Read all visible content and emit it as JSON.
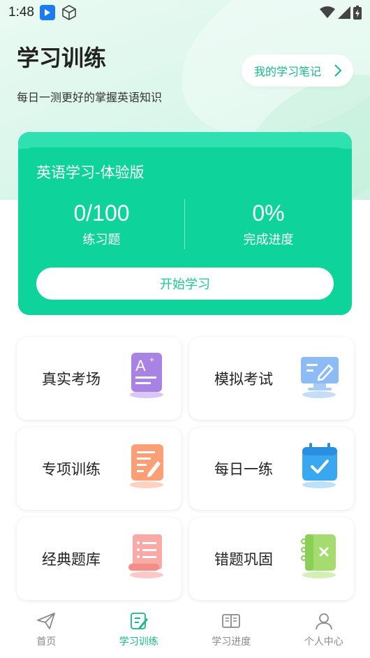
{
  "status_bar": {
    "time": "1:48"
  },
  "header": {
    "title": "学习训练",
    "subtitle": "每日一测更好的掌握英语知识",
    "notes_button": "我的学习笔记"
  },
  "course_card": {
    "title": "英语学习-体验版",
    "stats": [
      {
        "value": "0/100",
        "label": "练习题"
      },
      {
        "value": "0%",
        "label": "完成进度"
      }
    ],
    "start_button": "开始学习"
  },
  "tiles": [
    {
      "label": "真实考场",
      "icon": "exam-paper-icon"
    },
    {
      "label": "模拟考试",
      "icon": "monitor-edit-icon"
    },
    {
      "label": "专项训练",
      "icon": "notepad-edit-icon"
    },
    {
      "label": "每日一练",
      "icon": "calendar-check-icon"
    },
    {
      "label": "经典题库",
      "icon": "scroll-list-icon"
    },
    {
      "label": "错题巩固",
      "icon": "notebook-x-icon"
    }
  ],
  "tabbar": [
    {
      "label": "首页",
      "icon": "paper-plane-icon",
      "active": false
    },
    {
      "label": "学习训练",
      "icon": "edit-square-icon",
      "active": true
    },
    {
      "label": "学习进度",
      "icon": "open-book-icon",
      "active": false
    },
    {
      "label": "个人中心",
      "icon": "user-icon",
      "active": false
    }
  ],
  "colors": {
    "accent": "#0ed39b",
    "accent_text": "#17b98c",
    "tab_active": "#16b98a",
    "tab_inactive": "#8a8a8a"
  }
}
